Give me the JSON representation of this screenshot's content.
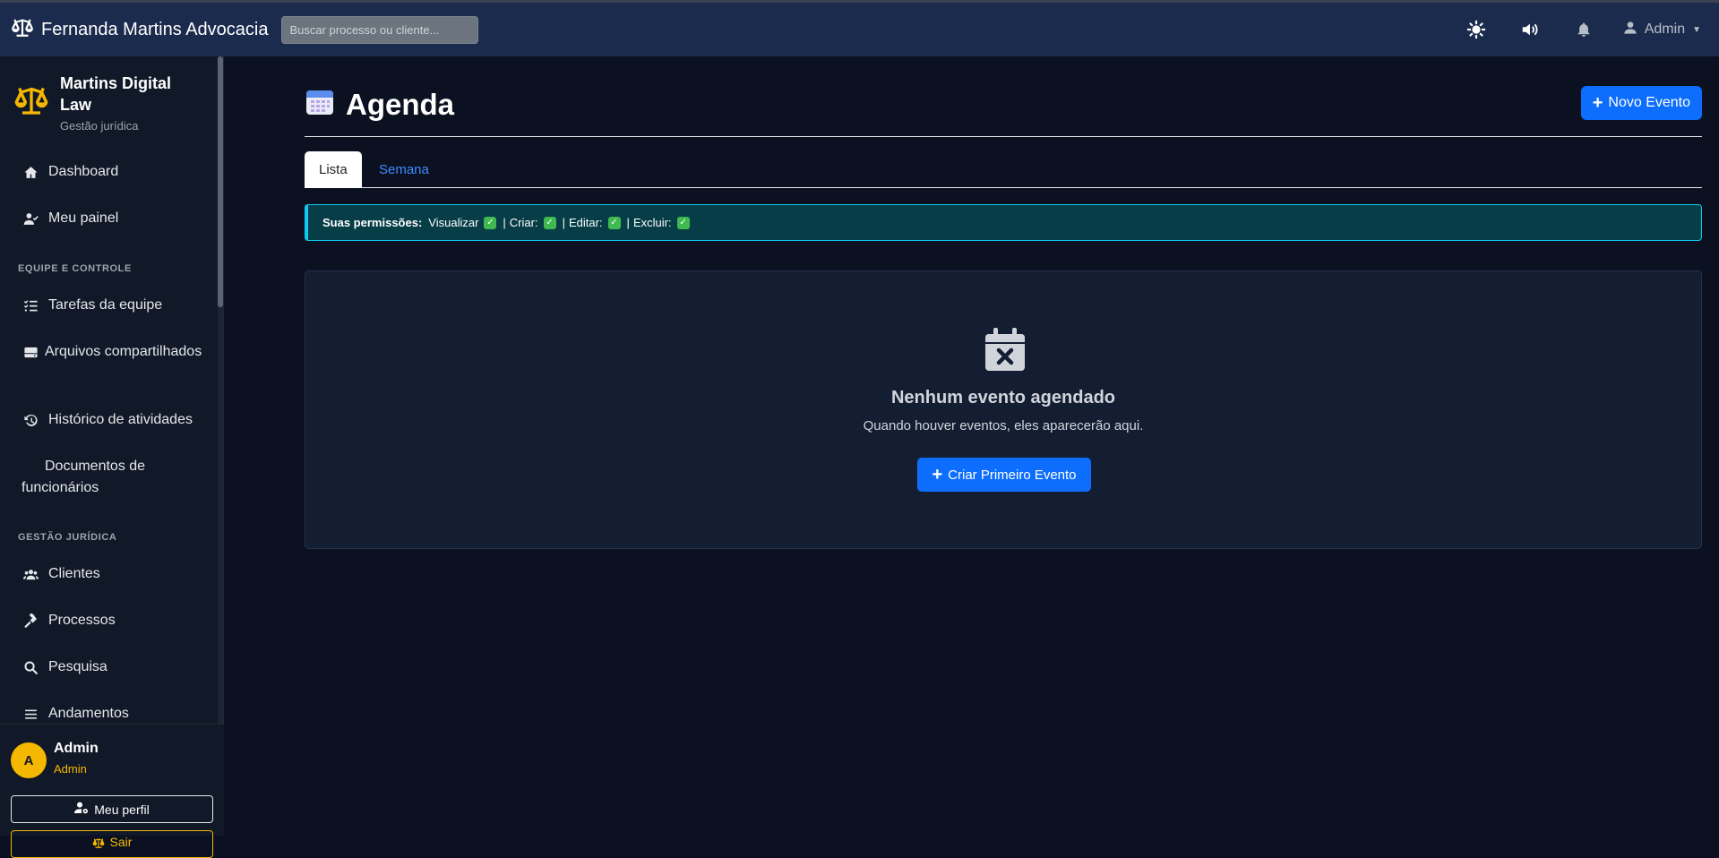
{
  "navbar": {
    "brand": "Fernanda Martins Advocacia",
    "search_placeholder": "Buscar processo ou cliente...",
    "icons": [
      "theme-icon",
      "volume-icon",
      "bell-icon",
      "user-icon"
    ],
    "user_label": "Admin"
  },
  "sidebar": {
    "brand_title": "Martins Digital Law",
    "brand_subtitle": "Gestão jurídica",
    "items_top": [
      {
        "label": "Dashboard",
        "icon": "home-icon"
      },
      {
        "label": "Meu painel",
        "icon": "user-check-icon"
      }
    ],
    "section_team": "EQUIPE E CONTROLE",
    "items_team": [
      {
        "label": "Tarefas da equipe",
        "icon": "tasks-icon"
      },
      {
        "label": "Arquivos compartilhados",
        "icon": "hdd-icon"
      },
      {
        "label": "Histórico de atividades",
        "icon": "history-icon"
      },
      {
        "label": "Documentos de funcionários",
        "icon": ""
      }
    ],
    "section_legal": "GESTÃO JURÍDICA",
    "items_legal": [
      {
        "label": "Clientes",
        "icon": "users-icon"
      },
      {
        "label": "Processos",
        "icon": "gavel-icon"
      },
      {
        "label": "Pesquisa",
        "icon": "search-icon"
      },
      {
        "label": "Andamentos",
        "icon": "list-icon"
      }
    ],
    "footer": {
      "avatar_initial": "A",
      "user_name": "Admin",
      "user_role": "Admin",
      "profile_button": "Meu perfil",
      "logout_button": "Sair"
    }
  },
  "main": {
    "page_title": "Agenda",
    "new_event_button": "Novo Evento",
    "tabs": [
      {
        "label": "Lista",
        "active": true
      },
      {
        "label": "Semana",
        "active": false
      }
    ],
    "permissions": {
      "label": "Suas permissões:",
      "items": [
        "Visualizar",
        "Criar:",
        "Editar:",
        "Excluir:"
      ],
      "separator": "|"
    },
    "empty_state": {
      "title": "Nenhum evento agendado",
      "subtitle": "Quando houver eventos, eles aparecerão aqui.",
      "button": "Criar Primeiro Evento"
    }
  },
  "colors": {
    "primary": "#0d6efd",
    "accent_gold": "#f5b800",
    "navbar_bg": "#1b2b4d",
    "page_bg": "#0b1120",
    "info_border": "#0dcaf0",
    "check_green": "#3fb950"
  }
}
